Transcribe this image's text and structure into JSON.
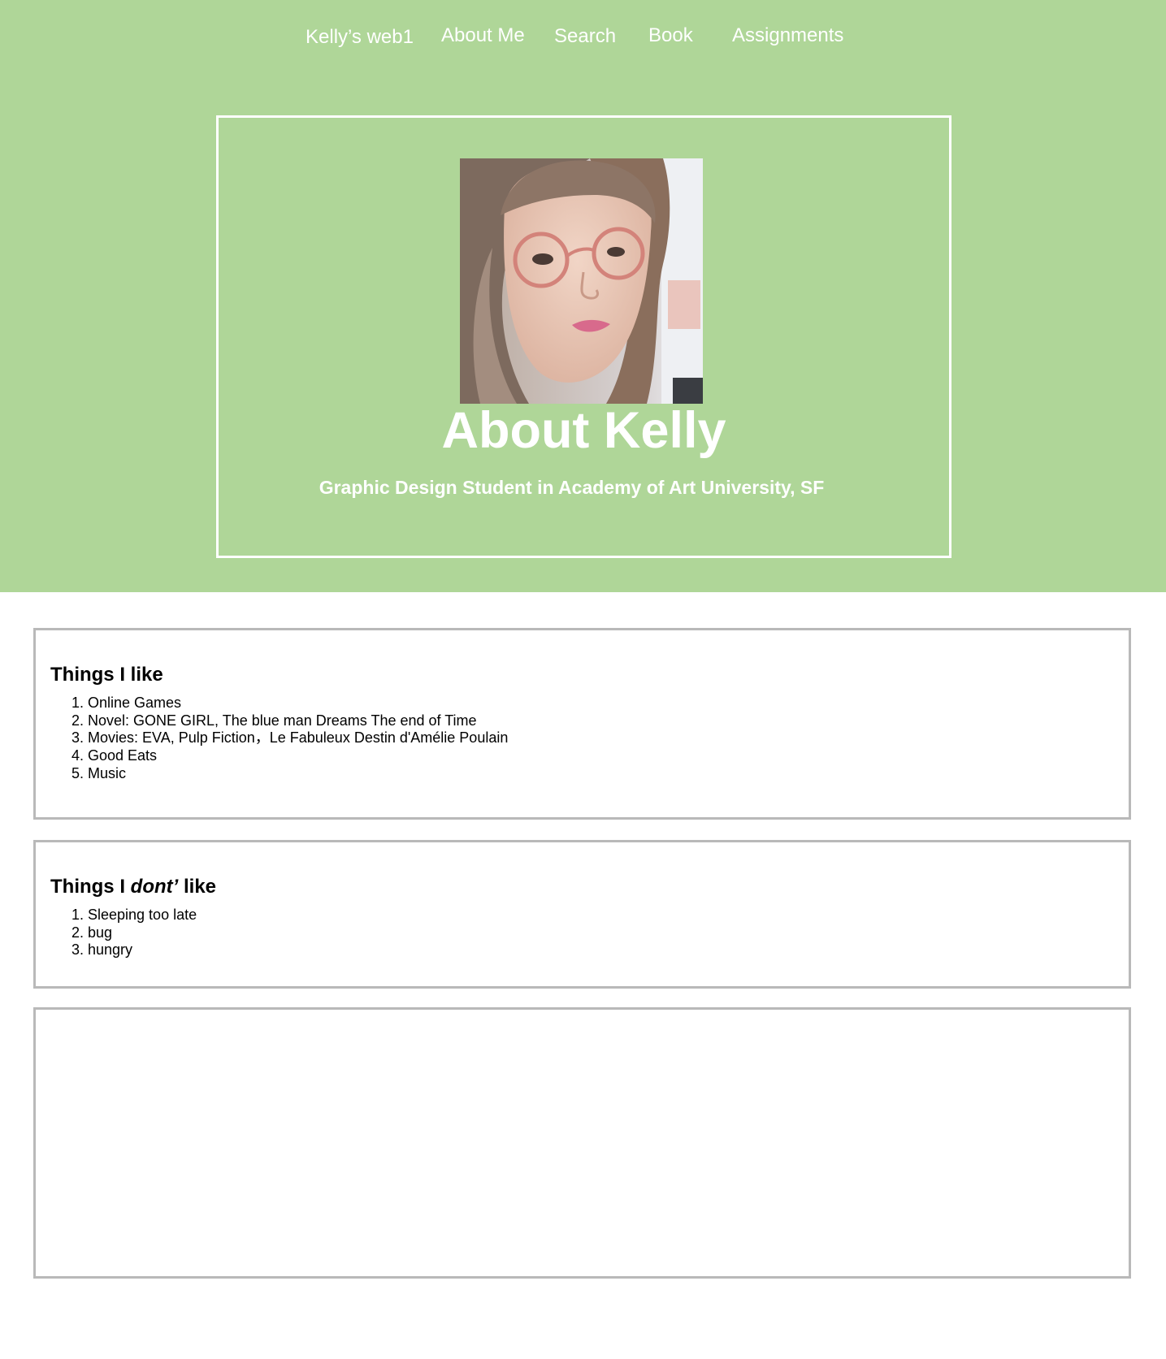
{
  "nav": {
    "brand": "Kelly’s web1",
    "items": [
      "About Me",
      "Search",
      "Book",
      "Assignments"
    ]
  },
  "hero": {
    "title": "About Kelly",
    "subtitle": "Graphic Design Student in Academy of Art University, SF",
    "background_color": "#afd698",
    "photo_alt": "Portrait of Kelly wearing round pink glasses"
  },
  "likes": {
    "heading": "Things I like",
    "items": [
      "Online Games",
      "Novel: GONE GIRL, The blue man Dreams The end of Time",
      "Movies: EVA, Pulp Fiction，Le Fabuleux Destin d'Amélie Poulain",
      "Good Eats",
      "Music"
    ]
  },
  "dislikes": {
    "heading_prefix": "Things I ",
    "heading_emphasis": "dont’",
    "heading_suffix": " like",
    "items": [
      "Sleeping too late",
      "bug",
      "hungry"
    ]
  }
}
